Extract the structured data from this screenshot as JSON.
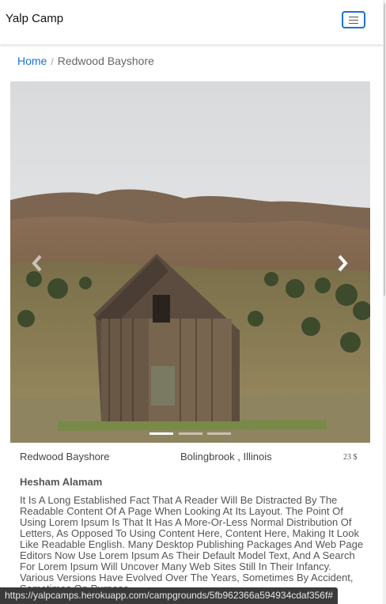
{
  "navbar": {
    "brand": "Yalp Camp",
    "toggle_icon": "hamburger-icon"
  },
  "breadcrumb": {
    "home": "Home",
    "separator": "/",
    "current": "Redwood Bayshore"
  },
  "carousel": {
    "image_alt": "Redwood Bayshore",
    "prev_icon": "chevron-left-icon",
    "next_icon": "chevron-right-icon",
    "slide_count": 3,
    "active_slide": 1
  },
  "campground": {
    "name": "Redwood Bayshore",
    "location": "Bolingbrook , Illinois",
    "price": "23 $",
    "author": "Hesham Alamam",
    "description": "It Is A Long Established Fact That A Reader Will Be Distracted By The Readable Content Of A Page When Looking At Its Layout. The Point Of Using Lorem Ipsum Is That It Has A More-Or-Less Normal Distribution Of Letters, As Opposed To Using Content Here, Content Here, Making It Look Like Readable English. Many Desktop Publishing Packages And Web Page Editors Now Use Lorem Ipsum As Their Default Model Text, And A Search For Lorem Ipsum Will Uncover Many Web Sites Still In Their Infancy. Various Versions Have Evolved Over The Years, Sometimes By Accident, Sometimes On Purpose."
  },
  "status_bar": {
    "url": "https://yalpcamps.herokuapp.com/campgrounds/5fb962366a594934cdaf356f#"
  },
  "colors": {
    "link": "#1a73d9",
    "toggler_border": "#1f6fd6",
    "muted_text": "#555555"
  }
}
